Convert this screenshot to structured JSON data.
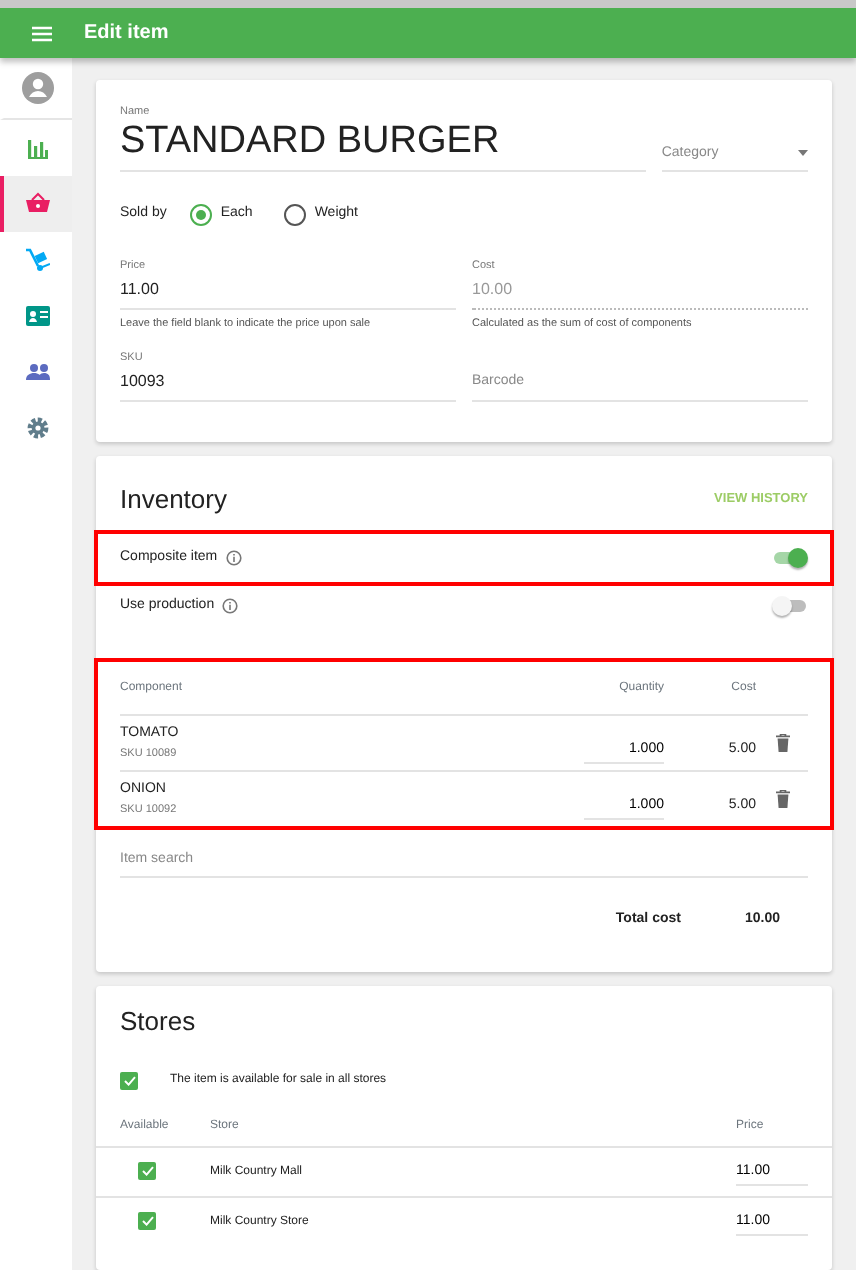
{
  "app_bar": {
    "title": "Edit item"
  },
  "sidebar": {
    "items": [
      {
        "kind": "account",
        "selected": false
      },
      {
        "kind": "reports",
        "selected": false
      },
      {
        "kind": "items",
        "selected": true
      },
      {
        "kind": "inventory",
        "selected": false
      },
      {
        "kind": "employees",
        "selected": false
      },
      {
        "kind": "customers",
        "selected": false
      },
      {
        "kind": "settings",
        "selected": false
      }
    ]
  },
  "item": {
    "name_label": "Name",
    "name": "STANDARD BURGER",
    "category_placeholder": "Category",
    "sold_by_label": "Sold by",
    "sold_by_options": [
      {
        "label": "Each",
        "selected": true
      },
      {
        "label": "Weight",
        "selected": false
      }
    ],
    "price_label": "Price",
    "price": "11.00",
    "price_hint": "Leave the field blank to indicate the price upon sale",
    "cost_label": "Cost",
    "cost": "10.00",
    "cost_hint": "Calculated as the sum of cost of components",
    "sku_label": "SKU",
    "sku": "10093",
    "barcode_placeholder": "Barcode"
  },
  "inventory": {
    "title": "Inventory",
    "view_history": "VIEW HISTORY",
    "toggles": [
      {
        "label": "Composite item",
        "on": true,
        "highlighted": true
      },
      {
        "label": "Use production",
        "on": false,
        "highlighted": false
      }
    ],
    "components": {
      "highlighted": true,
      "columns": [
        "Component",
        "Quantity",
        "Cost"
      ],
      "rows": [
        {
          "name": "TOMATO",
          "sku": "SKU 10089",
          "quantity": "1.000",
          "cost": "5.00"
        },
        {
          "name": "ONION",
          "sku": "SKU 10092",
          "quantity": "1.000",
          "cost": "5.00"
        }
      ]
    },
    "item_search_placeholder": "Item search",
    "total_label": "Total cost",
    "total": "10.00"
  },
  "stores": {
    "title": "Stores",
    "all_stores": {
      "label": "The item is available for sale in all stores",
      "checked": true
    },
    "columns": [
      "Available",
      "Store",
      "Price"
    ],
    "rows": [
      {
        "available": true,
        "name": "Milk Country Mall",
        "price": "11.00"
      },
      {
        "available": true,
        "name": "Milk Country Store",
        "price": "11.00"
      }
    ]
  }
}
